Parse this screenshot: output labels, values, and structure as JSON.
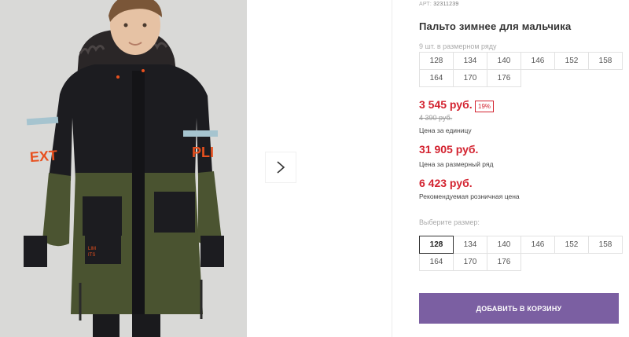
{
  "product": {
    "article_label": "АРТ:",
    "article_number": "32311239",
    "title": "Пальто зимнее для мальчика",
    "photo_alt": "product-photo"
  },
  "gallery": {
    "next_icon": "chevron-right-icon"
  },
  "size_set": {
    "caption": "9 шт. в размерном ряду",
    "sizes": [
      "128",
      "134",
      "140",
      "146",
      "152",
      "158",
      "164",
      "170",
      "176"
    ]
  },
  "pricing": {
    "unit_price": "3 545 руб.",
    "discount": "19%",
    "old_price": "4 390 руб.",
    "unit_caption": "Цена за единицу",
    "set_price": "31 905 руб.",
    "set_caption": "Цена за размерный ряд",
    "retail_price": "6 423 руб.",
    "retail_caption": "Рекомендуемая розничная цена"
  },
  "size_select": {
    "caption": "Выберите размер:",
    "selected": "128",
    "sizes": [
      "128",
      "134",
      "140",
      "146",
      "152",
      "158",
      "164",
      "170",
      "176"
    ]
  },
  "cart_button": {
    "label": "ДОБАВИТЬ В КОРЗИНУ"
  },
  "colors": {
    "price_red": "#d32330",
    "button_purple": "#7b5fa2",
    "coat_black": "#1c1c20",
    "coat_khaki": "#4a5330",
    "accent_orange": "#e8501e"
  }
}
